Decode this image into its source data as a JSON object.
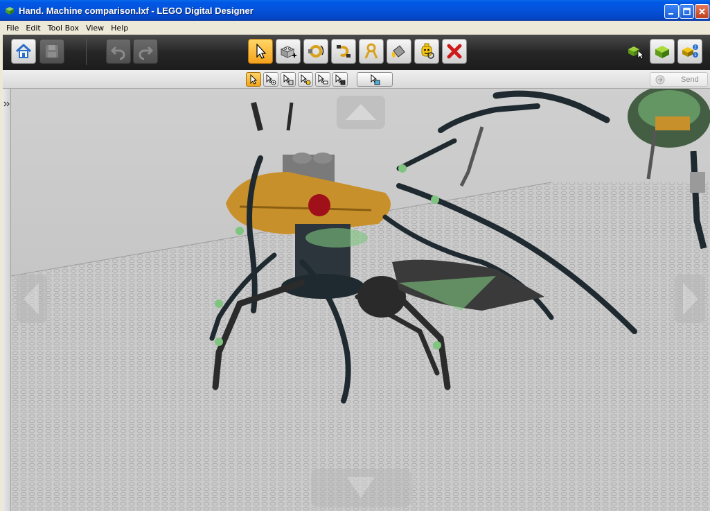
{
  "window": {
    "title": "Hand. Machine comparison.lxf - LEGO Digital Designer"
  },
  "menu": {
    "items": [
      "File",
      "Edit",
      "Tool Box",
      "View",
      "Help"
    ]
  },
  "sub_toolbar": {
    "send_label": "Send"
  },
  "colors": {
    "titlebar": "#0552d8",
    "toolbar_dark": "#262626",
    "active_tool": "#f4a21c",
    "viewport_bg": "#c6c6c6",
    "model_dark": "#1f2a30",
    "model_orange": "#c8902a",
    "model_green_trans": "#7fc47f"
  },
  "icons": {
    "home": "home-icon",
    "save": "save-icon",
    "undo": "undo-icon",
    "redo": "redo-icon",
    "select": "cursor-icon",
    "add_brick": "add-brick-icon",
    "hinge": "hinge-icon",
    "hinge_align": "hinge-align-icon",
    "flex": "flex-icon",
    "paint": "paint-bucket-icon",
    "hide": "minifig-head-icon",
    "delete": "delete-icon",
    "build_mode": "build-mode-icon",
    "view_mode": "view-mode-icon",
    "building_guide": "building-guide-icon"
  }
}
